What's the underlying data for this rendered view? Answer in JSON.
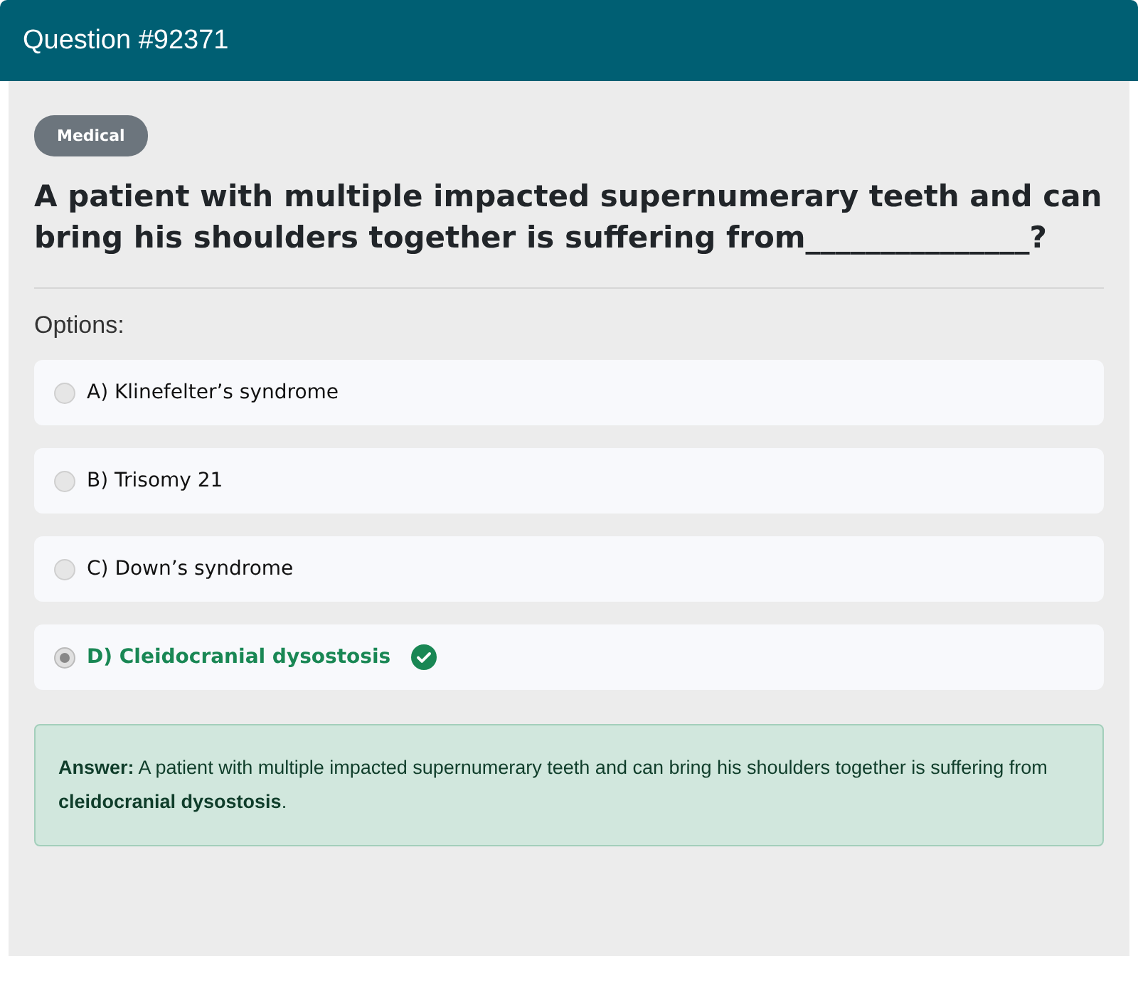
{
  "header": {
    "title": "Question #92371"
  },
  "category": "Medical",
  "question": "A patient with multiple impacted supernumerary teeth and can bring his shoulders together is suffering from_______________?",
  "options_label": "Options:",
  "options": [
    {
      "text": "A) Klinefelter’s syndrome",
      "selected": false,
      "correct": false
    },
    {
      "text": "B) Trisomy 21",
      "selected": false,
      "correct": false
    },
    {
      "text": "C) Down’s syndrome",
      "selected": false,
      "correct": false
    },
    {
      "text": "D) Cleidocranial dysostosis",
      "selected": true,
      "correct": true
    }
  ],
  "answer": "**Answer:** A patient with multiple impacted supernumerary teeth and can bring his shoulders together is suffering from **cleidocranial dysostosis**."
}
